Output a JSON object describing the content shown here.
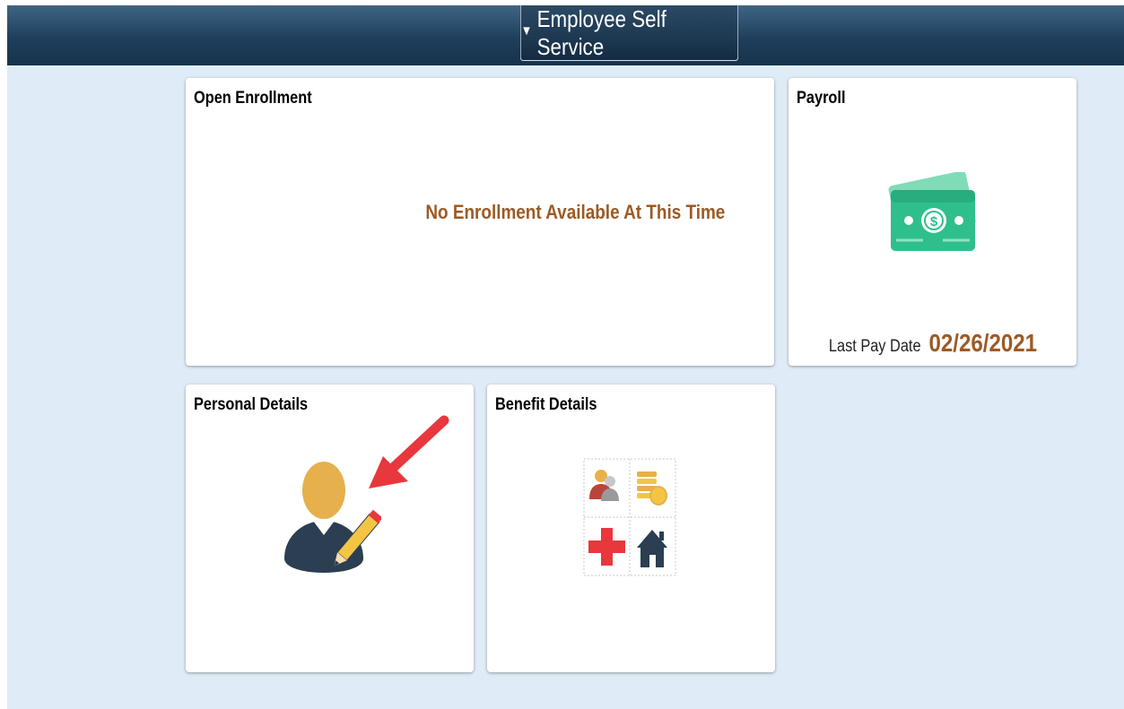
{
  "header": {
    "homepage_selector_label": "Employee Self Service",
    "caret": "▼"
  },
  "tiles": {
    "open_enrollment": {
      "title": "Open Enrollment",
      "message": "No Enrollment Available At This Time"
    },
    "payroll": {
      "title": "Payroll",
      "icon": "money-icon",
      "last_pay_date_label": "Last Pay Date",
      "last_pay_date_value": "02/26/2021"
    },
    "personal_details": {
      "title": "Personal Details",
      "icon": "person-edit-icon",
      "annotation": "red-arrow"
    },
    "benefit_details": {
      "title": "Benefit Details",
      "icon": "benefits-grid-icon",
      "sub_icons": [
        "people-icon",
        "coins-icon",
        "medical-cross-icon",
        "house-icon"
      ]
    }
  },
  "colors": {
    "banner": "#1f3f5c",
    "page_background": "#dfebf6",
    "accent_text": "#9c5a25",
    "money_green": "#2fbf8c",
    "person_head": "#e6b04c",
    "person_body": "#2b3e52",
    "arrow_red": "#e8373d"
  }
}
